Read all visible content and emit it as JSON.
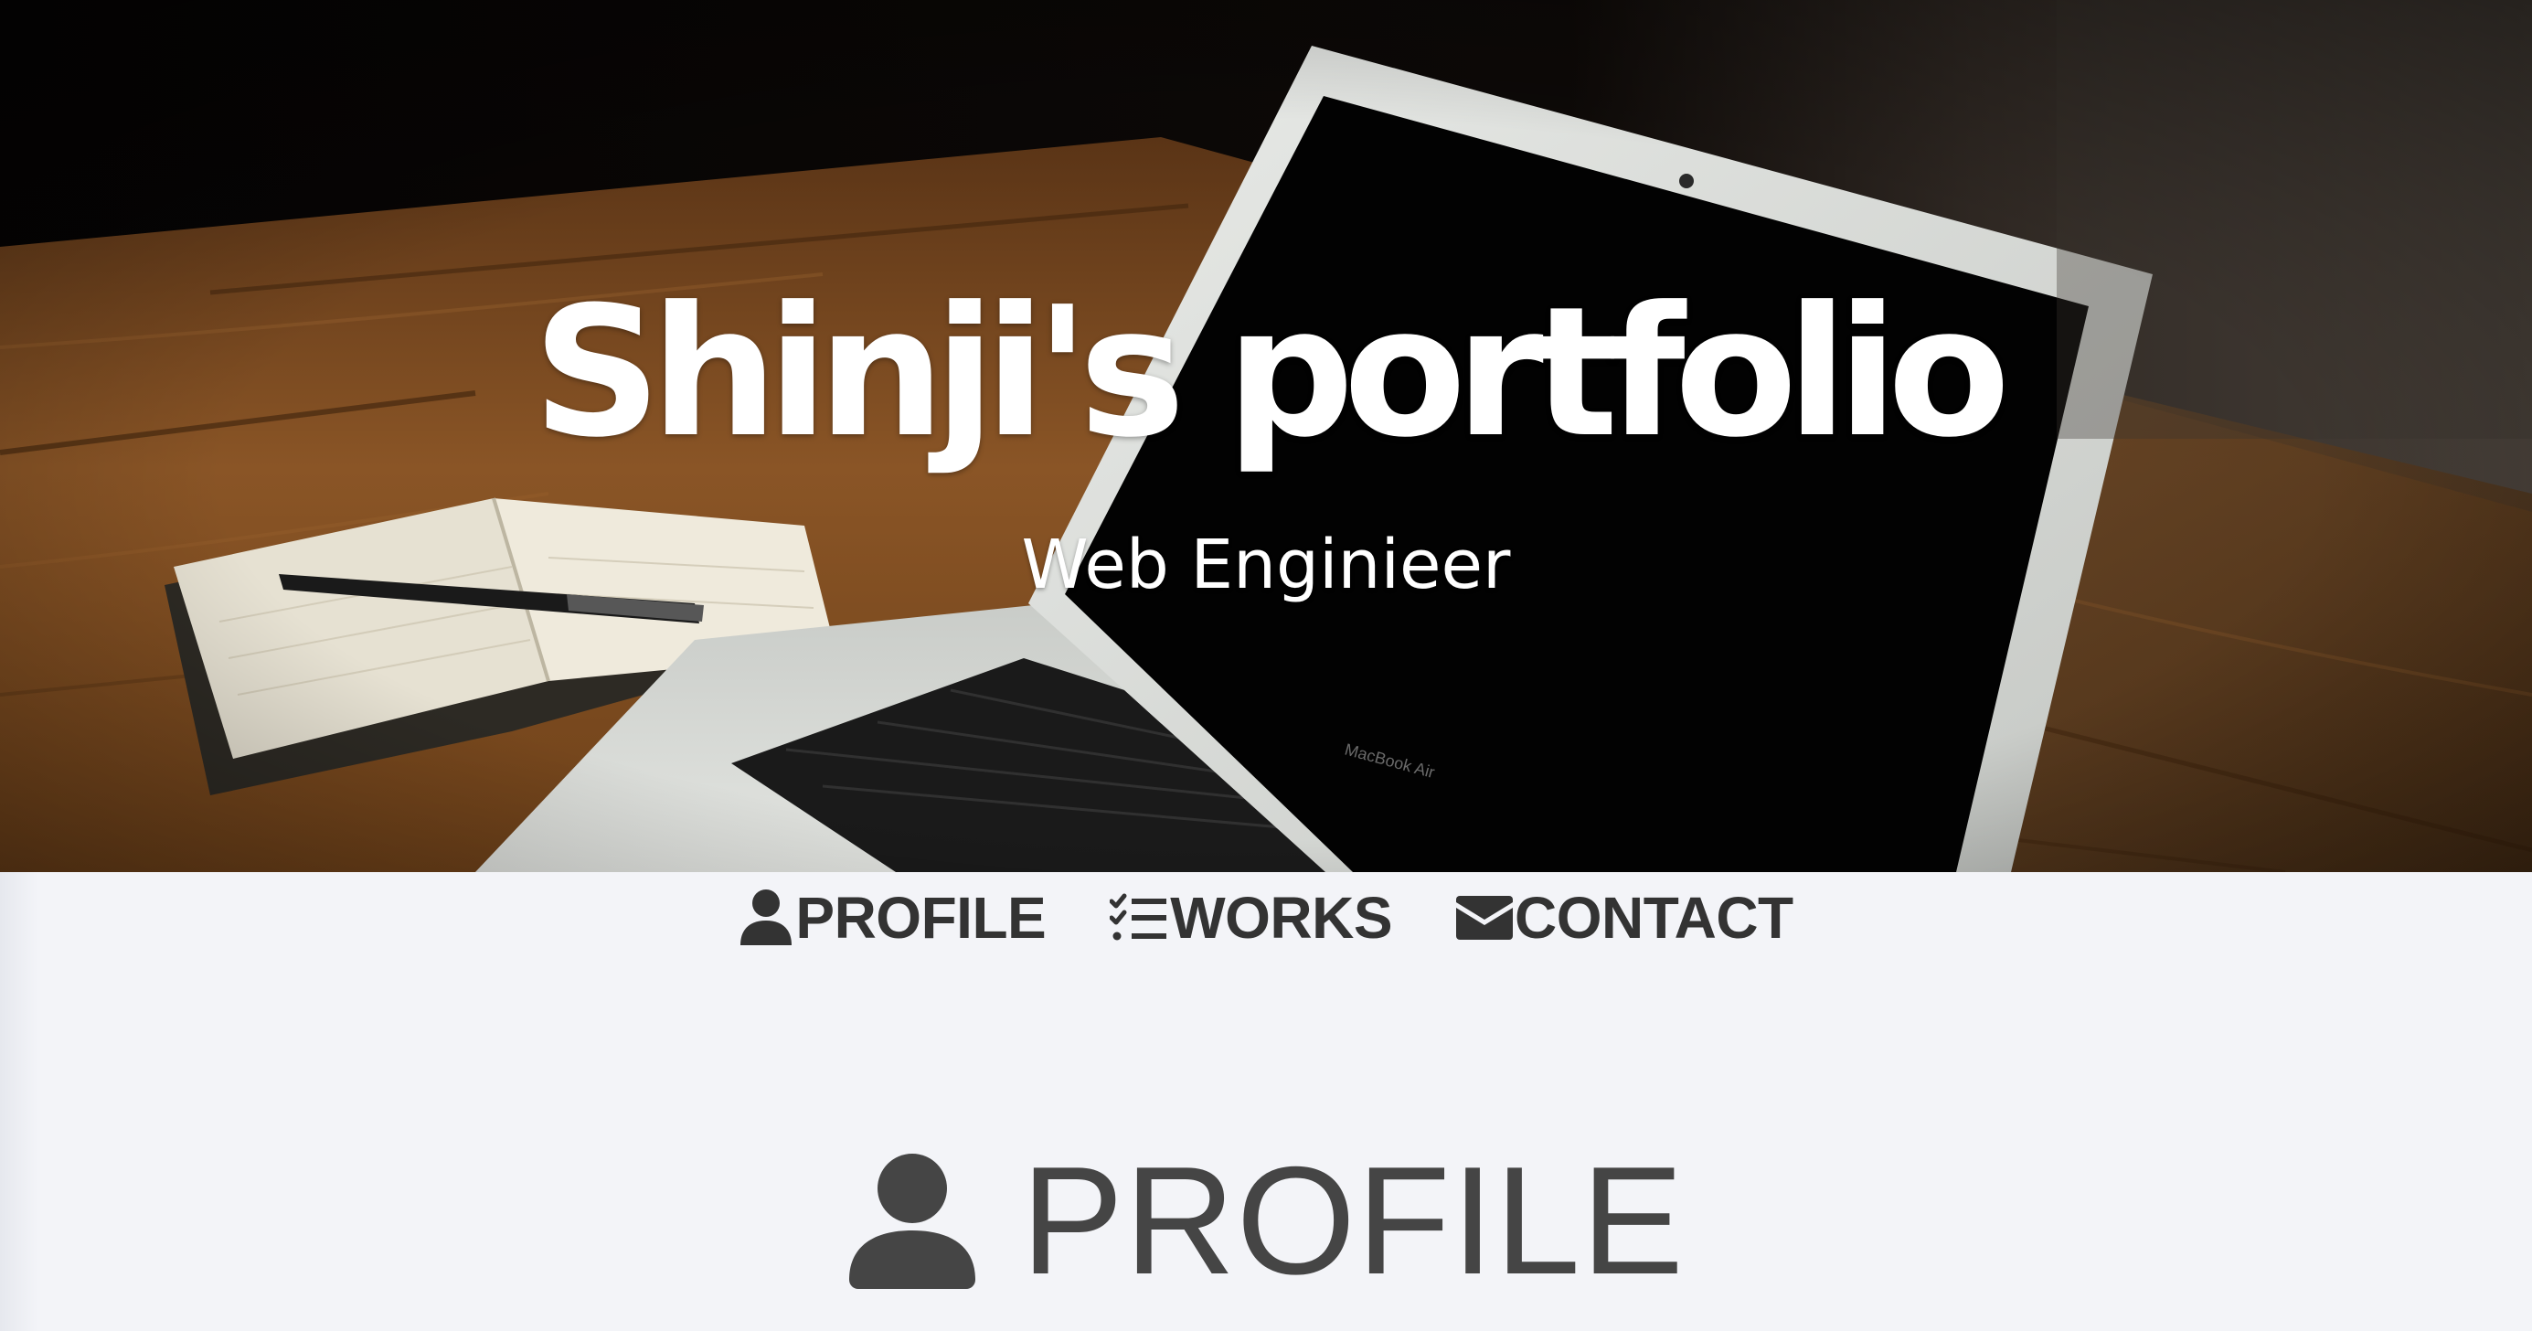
{
  "hero": {
    "title": "Shinji's portfolio",
    "subtitle": "Web Enginieer"
  },
  "nav": {
    "items": [
      {
        "label": "PROFILE",
        "icon": "user-icon"
      },
      {
        "label": "WORKS",
        "icon": "list-check-icon"
      },
      {
        "label": "CONTACT",
        "icon": "envelope-icon"
      }
    ]
  },
  "section": {
    "title": "PROFILE",
    "icon": "user-icon"
  },
  "colors": {
    "page_background": "#f3f4f8",
    "nav_text": "#333333",
    "section_heading": "#454545",
    "hero_text": "#ffffff"
  }
}
